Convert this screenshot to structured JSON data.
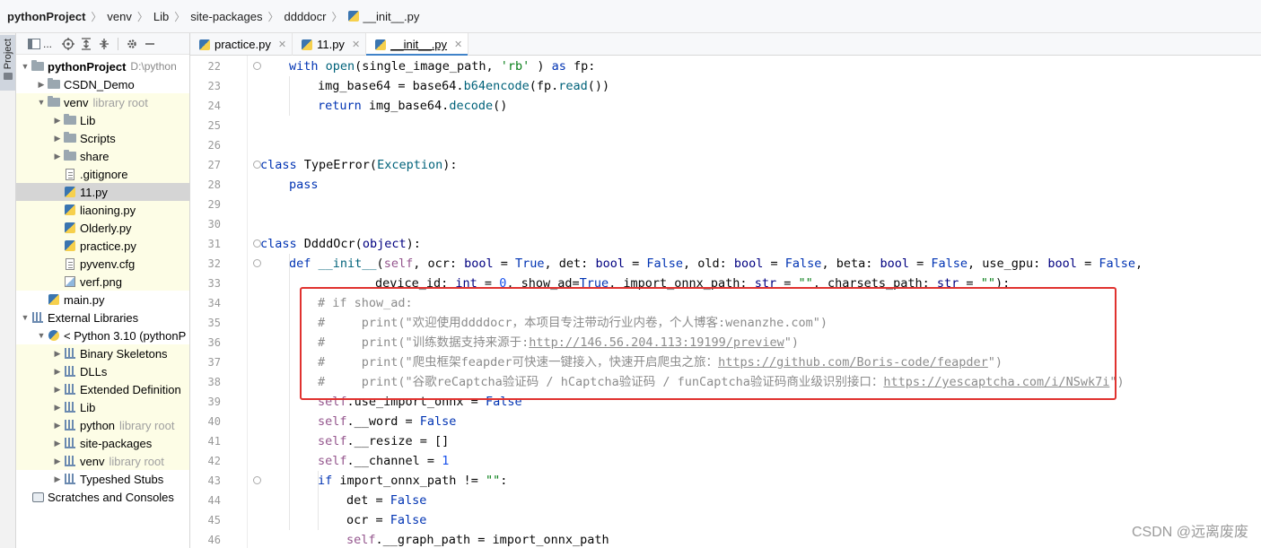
{
  "breadcrumb": [
    "pythonProject",
    "venv",
    "Lib",
    "site-packages",
    "ddddocr",
    "__init__.py"
  ],
  "tool_window": {
    "stripe_label": "Project",
    "toolbar_dots": "..."
  },
  "project_tree": [
    {
      "label": "pythonProject",
      "hint": "D:\\python",
      "depth": 0,
      "arrow": "down",
      "icon": "folder-icon",
      "bold": true
    },
    {
      "label": "CSDN_Demo",
      "depth": 1,
      "arrow": "right",
      "icon": "folder-icon"
    },
    {
      "label": "venv",
      "hint": "library root",
      "depth": 1,
      "arrow": "down",
      "icon": "folder-icon",
      "lib": true
    },
    {
      "label": "Lib",
      "depth": 2,
      "arrow": "right",
      "icon": "folder-icon",
      "lib": true
    },
    {
      "label": "Scripts",
      "depth": 2,
      "arrow": "right",
      "icon": "folder-icon",
      "lib": true
    },
    {
      "label": "share",
      "depth": 2,
      "arrow": "right",
      "icon": "folder-icon",
      "lib": true
    },
    {
      "label": ".gitignore",
      "depth": 2,
      "icon": "gitignore-icon",
      "lib": true
    },
    {
      "label": "11.py",
      "depth": 2,
      "icon": "python-file-icon",
      "selected": true
    },
    {
      "label": "liaoning.py",
      "depth": 2,
      "icon": "python-file-icon",
      "lib": true
    },
    {
      "label": "Olderly.py",
      "depth": 2,
      "icon": "python-file-icon",
      "lib": true
    },
    {
      "label": "practice.py",
      "depth": 2,
      "icon": "python-file-icon",
      "lib": true
    },
    {
      "label": "pyvenv.cfg",
      "depth": 2,
      "icon": "config-file-icon",
      "lib": true
    },
    {
      "label": "verf.png",
      "depth": 2,
      "icon": "image-file-icon",
      "lib": true
    },
    {
      "label": "main.py",
      "depth": 1,
      "icon": "python-file-icon"
    },
    {
      "label": "External Libraries",
      "depth": 0,
      "arrow": "down",
      "icon": "library-icon"
    },
    {
      "label": "< Python 3.10 (pythonP",
      "depth": 1,
      "arrow": "down",
      "icon": "python-sdk-icon"
    },
    {
      "label": "Binary Skeletons",
      "depth": 2,
      "arrow": "right",
      "icon": "library-icon",
      "lib": true
    },
    {
      "label": "DLLs",
      "depth": 2,
      "arrow": "right",
      "icon": "library-icon",
      "lib": true
    },
    {
      "label": "Extended Definition",
      "depth": 2,
      "arrow": "right",
      "icon": "library-icon",
      "lib": true
    },
    {
      "label": "Lib",
      "depth": 2,
      "arrow": "right",
      "icon": "library-icon",
      "lib": true
    },
    {
      "label": "python",
      "hint": "library root",
      "depth": 2,
      "arrow": "right",
      "icon": "library-icon",
      "lib": true
    },
    {
      "label": "site-packages",
      "depth": 2,
      "arrow": "right",
      "icon": "library-icon",
      "lib": true
    },
    {
      "label": "venv",
      "hint": "library root",
      "depth": 2,
      "arrow": "right",
      "icon": "library-icon",
      "lib": true
    },
    {
      "label": "Typeshed Stubs",
      "depth": 2,
      "arrow": "right",
      "icon": "library-icon"
    },
    {
      "label": "Scratches and Consoles",
      "depth": 0,
      "icon": "scratches-icon"
    }
  ],
  "tabs": [
    {
      "label": "practice.py",
      "active": false
    },
    {
      "label": "11.py",
      "active": false
    },
    {
      "label": "__init__.py",
      "active": true
    }
  ],
  "editor": {
    "lines": [
      {
        "n": "22",
        "indent": 1,
        "tokens": [
          [
            "kw",
            "with "
          ],
          [
            "fn",
            "open"
          ],
          [
            "",
            "(single_image_path, "
          ],
          [
            "str",
            "'rb'"
          ],
          [
            "",
            " ) "
          ],
          [
            "kw",
            "as"
          ],
          [
            "",
            " fp:"
          ]
        ]
      },
      {
        "n": "23",
        "indent": 2,
        "tokens": [
          [
            "",
            "img_base64 = base64."
          ],
          [
            "fn",
            "b64encode"
          ],
          [
            "",
            "(fp."
          ],
          [
            "fn",
            "read"
          ],
          [
            "",
            "())"
          ]
        ]
      },
      {
        "n": "24",
        "indent": 2,
        "tokens": [
          [
            "kw",
            "return "
          ],
          [
            "",
            "img_base64."
          ],
          [
            "fn",
            "decode"
          ],
          [
            "",
            "()"
          ]
        ]
      },
      {
        "n": "25",
        "indent": 0,
        "tokens": []
      },
      {
        "n": "26",
        "indent": 0,
        "tokens": []
      },
      {
        "n": "27",
        "indent": 0,
        "tokens": [
          [
            "kw",
            "class "
          ],
          [
            "",
            "TypeError("
          ],
          [
            "fn",
            "Exception"
          ],
          [
            "",
            "):"
          ]
        ]
      },
      {
        "n": "28",
        "indent": 1,
        "tokens": [
          [
            "kw",
            "pass"
          ]
        ]
      },
      {
        "n": "29",
        "indent": 0,
        "tokens": []
      },
      {
        "n": "30",
        "indent": 0,
        "tokens": []
      },
      {
        "n": "31",
        "indent": 0,
        "tokens": [
          [
            "kw",
            "class "
          ],
          [
            "",
            "DdddOcr("
          ],
          [
            "bi",
            "object"
          ],
          [
            "",
            "):"
          ]
        ]
      },
      {
        "n": "32",
        "indent": 1,
        "tokens": [
          [
            "kw",
            "def "
          ],
          [
            "fn",
            "__init__"
          ],
          [
            "",
            "("
          ],
          [
            "sf",
            "self"
          ],
          [
            "",
            ", ocr: "
          ],
          [
            "bi",
            "bool"
          ],
          [
            "",
            " = "
          ],
          [
            "kw",
            "True"
          ],
          [
            "",
            ", det: "
          ],
          [
            "bi",
            "bool"
          ],
          [
            "",
            " = "
          ],
          [
            "kw",
            "False"
          ],
          [
            "",
            ", old: "
          ],
          [
            "bi",
            "bool"
          ],
          [
            "",
            " = "
          ],
          [
            "kw",
            "False"
          ],
          [
            "",
            ", beta: "
          ],
          [
            "bi",
            "bool"
          ],
          [
            "",
            " = "
          ],
          [
            "kw",
            "False"
          ],
          [
            "",
            ", use_gpu: "
          ],
          [
            "bi",
            "bool"
          ],
          [
            "",
            " = "
          ],
          [
            "kw",
            "False"
          ],
          [
            "",
            ","
          ]
        ]
      },
      {
        "n": "33",
        "indent": 4,
        "tokens": [
          [
            "",
            "device_id: "
          ],
          [
            "bi",
            "int"
          ],
          [
            "",
            " = "
          ],
          [
            "num",
            "0"
          ],
          [
            "",
            ", show_ad="
          ],
          [
            "kw",
            "True"
          ],
          [
            "",
            ", import_onnx_path: "
          ],
          [
            "bi",
            "str"
          ],
          [
            "",
            " = "
          ],
          [
            "str",
            "\"\""
          ],
          [
            "",
            ", charsets_path: "
          ],
          [
            "bi",
            "str"
          ],
          [
            "",
            " = "
          ],
          [
            "str",
            "\"\""
          ],
          [
            "",
            "):"
          ]
        ]
      },
      {
        "n": "34",
        "indent": 2,
        "tokens": [
          [
            "cm",
            "# if show_ad:"
          ]
        ]
      },
      {
        "n": "35",
        "indent": 2,
        "tokens": [
          [
            "cm",
            "#     print(\"欢迎使用ddddocr，本项目专注带动行业内卷，个人博客:wenanzhe.com\")"
          ]
        ]
      },
      {
        "n": "36",
        "indent": 2,
        "tokens": [
          [
            "cm",
            "#     print(\"训练数据支持来源于:"
          ],
          [
            "link",
            "http://146.56.204.113:19199/preview"
          ],
          [
            "cm",
            "\")"
          ]
        ]
      },
      {
        "n": "37",
        "indent": 2,
        "tokens": [
          [
            "cm",
            "#     print(\"爬虫框架feapder可快速一键接入，快速开启爬虫之旅："
          ],
          [
            "link",
            "https://github.com/Boris-code/feapder"
          ],
          [
            "cm",
            "\")"
          ]
        ]
      },
      {
        "n": "38",
        "indent": 2,
        "tokens": [
          [
            "cm",
            "#     print(\"谷歌reCaptcha验证码 / hCaptcha验证码 / funCaptcha验证码商业级识别接口："
          ],
          [
            "link",
            "https://yescaptcha.com/i/NSwk7i"
          ],
          [
            "cm",
            "\")"
          ]
        ]
      },
      {
        "n": "39",
        "indent": 2,
        "tokens": [
          [
            "sf",
            "self"
          ],
          [
            "",
            ".use_import_onnx = "
          ],
          [
            "kw",
            "False"
          ]
        ]
      },
      {
        "n": "40",
        "indent": 2,
        "tokens": [
          [
            "sf",
            "self"
          ],
          [
            "",
            ".__word = "
          ],
          [
            "kw",
            "False"
          ]
        ]
      },
      {
        "n": "41",
        "indent": 2,
        "tokens": [
          [
            "sf",
            "self"
          ],
          [
            "",
            ".__resize = []"
          ]
        ]
      },
      {
        "n": "42",
        "indent": 2,
        "tokens": [
          [
            "sf",
            "self"
          ],
          [
            "",
            ".__channel = "
          ],
          [
            "num",
            "1"
          ]
        ]
      },
      {
        "n": "43",
        "indent": 2,
        "tokens": [
          [
            "kw",
            "if "
          ],
          [
            "",
            "import_onnx_path != "
          ],
          [
            "str",
            "\"\""
          ],
          [
            "",
            ":"
          ]
        ]
      },
      {
        "n": "44",
        "indent": 3,
        "tokens": [
          [
            "",
            "det = "
          ],
          [
            "kw",
            "False"
          ]
        ]
      },
      {
        "n": "45",
        "indent": 3,
        "tokens": [
          [
            "",
            "ocr = "
          ],
          [
            "kw",
            "False"
          ]
        ]
      },
      {
        "n": "46",
        "indent": 3,
        "tokens": [
          [
            "sf",
            "self"
          ],
          [
            "",
            ".__graph_path = import_onnx_path"
          ]
        ]
      }
    ]
  },
  "watermark": "CSDN @远离废废",
  "colors": {
    "highlight_box": "#e0322f",
    "library_bg": "#fdfde6",
    "selected_bg": "#d5d5d5",
    "tab_active_underline": "#4083c9"
  }
}
